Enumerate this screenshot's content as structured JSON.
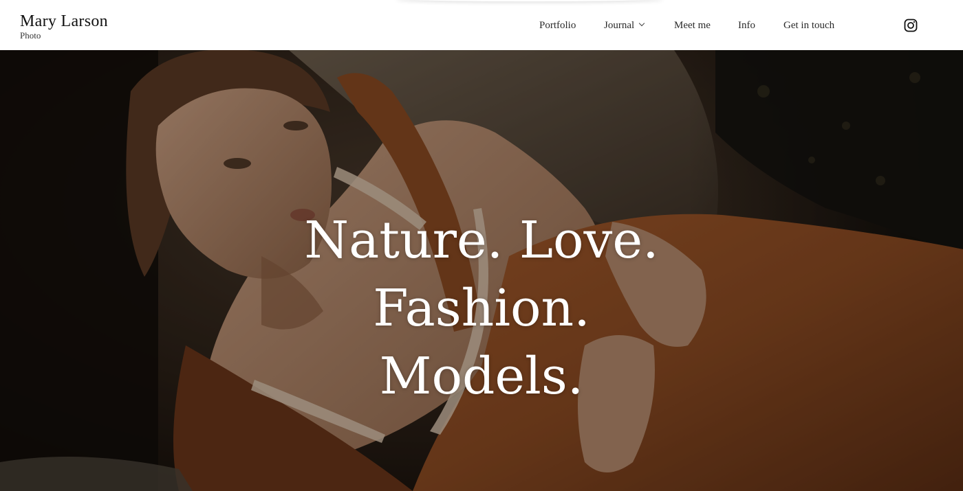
{
  "site": {
    "name": "Mary Larson",
    "subtitle": "Photo"
  },
  "nav": {
    "items": [
      {
        "label": "Portfolio"
      },
      {
        "label": "Journal",
        "has_dropdown": true
      },
      {
        "label": "Meet me"
      },
      {
        "label": "Info"
      },
      {
        "label": "Get in touch"
      }
    ],
    "social_icon": "instagram-icon"
  },
  "hero": {
    "headline_lines": [
      "Nature. Love.",
      "Fashion.",
      "Models."
    ],
    "image_subject": "woman reclining on rocks in rust-colored overalls"
  },
  "colors": {
    "header_bg": "#ffffff",
    "nav_text": "#2a2a2a",
    "hero_text": "#ffffff",
    "rust": "#8a4a22"
  }
}
